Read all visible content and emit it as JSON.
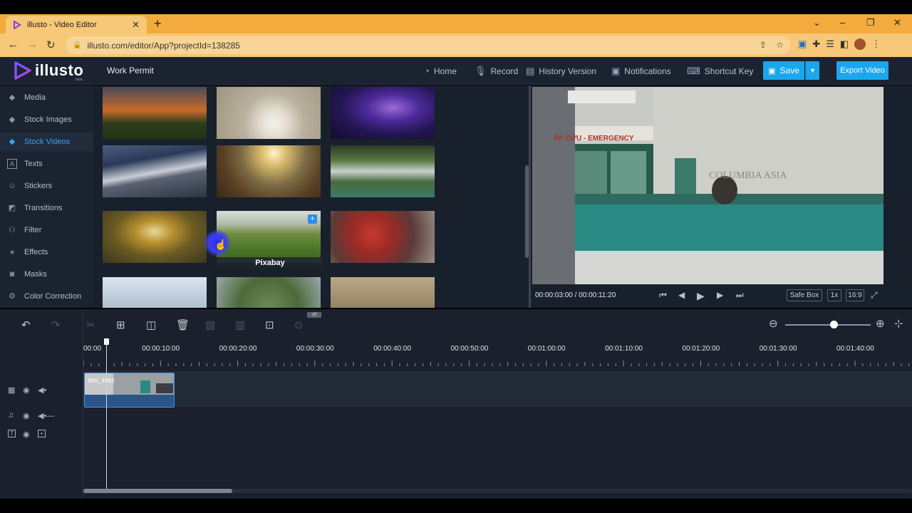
{
  "browser": {
    "tab_title": "illusto - Video Editor",
    "tab_close": "✕",
    "new_tab": "+",
    "url": "illusto.com/editor/App?projectId=138285",
    "window_controls": [
      "⌄",
      "–",
      "❐",
      "✕"
    ]
  },
  "app": {
    "logo_word": "illusto",
    "logo_beta": "beta",
    "project_name": "Work Permit",
    "nav": [
      {
        "label": "Home",
        "icon": "home-icon"
      },
      {
        "label": "Record",
        "icon": "microphone-icon"
      },
      {
        "label": "History Version",
        "icon": "history-icon"
      },
      {
        "label": "Notifications",
        "icon": "bell-icon"
      },
      {
        "label": "Shortcut Key",
        "icon": "keyboard-icon"
      }
    ],
    "save_label": "Save",
    "export_label": "Export Video",
    "accent": "#1aa7f0"
  },
  "sidebar": {
    "items": [
      {
        "label": "Media",
        "icon": "layers-icon"
      },
      {
        "label": "Stock Images",
        "icon": "layers-icon"
      },
      {
        "label": "Stock Videos",
        "icon": "layers-icon",
        "active": true
      },
      {
        "label": "Texts",
        "icon": "text-icon"
      },
      {
        "label": "Stickers",
        "icon": "smiley-icon"
      },
      {
        "label": "Transitions",
        "icon": "transition-icon"
      },
      {
        "label": "Filter",
        "icon": "filter-icon"
      },
      {
        "label": "Effects",
        "icon": "magic-wand-icon"
      },
      {
        "label": "Masks",
        "icon": "mask-icon"
      },
      {
        "label": "Color Correction",
        "icon": "color-correction-icon"
      }
    ]
  },
  "media": {
    "hover_caption": "Pixabay",
    "add_label": "+"
  },
  "preview": {
    "current_time": "00:00:03:00",
    "separator": "/",
    "total_time": "00:00:11:20",
    "safe_box": "Safe Box",
    "speed": "1x",
    "ratio": "16:9"
  },
  "timeline": {
    "off_badge": "off",
    "ticks": [
      "00:00",
      "00:00:10:00",
      "00:00:20:00",
      "00:00:30:00",
      "00:00:40:00",
      "00:00:50:00",
      "00:01:00:00",
      "00:01:10:00",
      "00:01:20:00",
      "00:01:30:00",
      "00:01:40:00"
    ],
    "clip_label": "IMG_4983",
    "scroll_fraction": 0.18
  }
}
